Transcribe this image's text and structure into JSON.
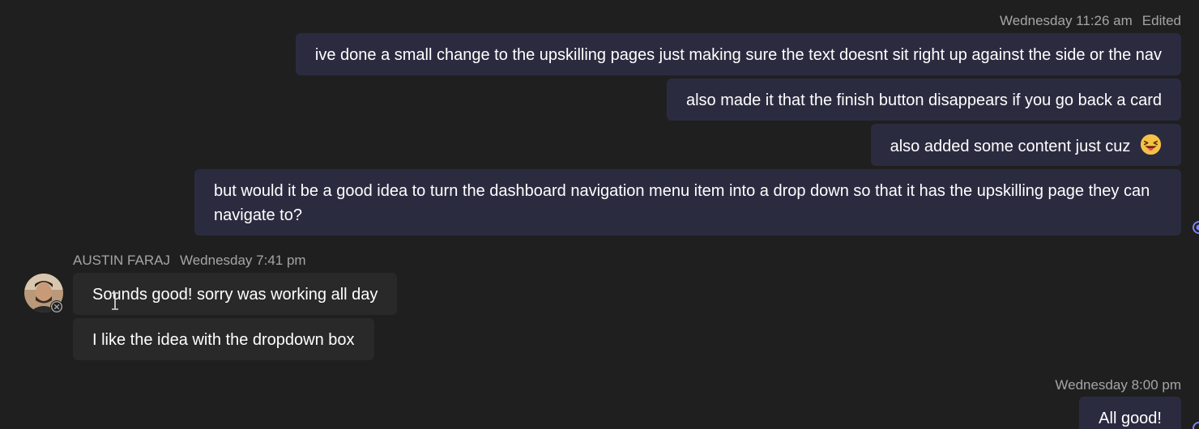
{
  "messages_block_1": {
    "timestamp": "Wednesday 11:26 am",
    "edited_label": "Edited",
    "msg1": "ive done a small change to the upskilling pages just making sure the text doesnt sit right up against the side or the nav",
    "msg2": "also made it that the finish button disappears if you go back a card",
    "msg3": "also added some content just cuz",
    "msg3_emoji": "grinning-squinting-tongue-emoji",
    "msg4": "but would it be a good idea to turn the dashboard navigation menu item into a drop down so that it has the upskilling page they can navigate to?"
  },
  "messages_block_2": {
    "sender": "AUSTIN FARAJ",
    "timestamp": "Wednesday 7:41 pm",
    "msg1": "Sounds good! sorry was working all day",
    "msg2": "I like the idea with the dropdown box",
    "presence_icon": "offline-x-icon"
  },
  "messages_block_3": {
    "timestamp": "Wednesday 8:00 pm",
    "msg1": "All good!"
  },
  "colors": {
    "background": "#1f1f1f",
    "my_bubble": "#2b2b40",
    "their_bubble": "#292929",
    "meta_text": "#a5a5a5",
    "accent": "#7f85f5"
  }
}
